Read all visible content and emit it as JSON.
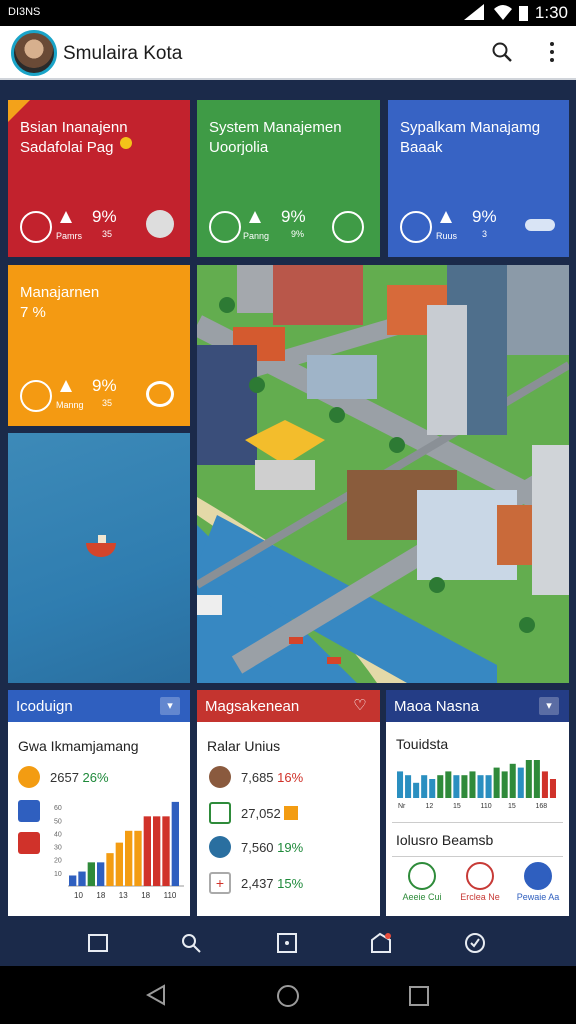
{
  "status_bar": {
    "carrier": "DI3NS",
    "time": "1:30"
  },
  "app": {
    "title": "Smulaira Kota"
  },
  "tiles": {
    "red": {
      "title": "Bsian Inanajenn\nSadafolai Pag",
      "pct": "9%",
      "small1": "Pamrs",
      "small2": "35",
      "color": "#c2222d"
    },
    "green": {
      "title": "System Manajemen\nUoorjolia",
      "pct": "9%",
      "small1": "Panng",
      "small2": "9%",
      "color": "#3f9b46"
    },
    "blue": {
      "title": "Sypalkam Manajamg\nBaaak",
      "pct": "9%",
      "small1": "Ruus",
      "small2": "3",
      "color": "#3763c4"
    },
    "orange": {
      "title": "Manajarnen\n7 %",
      "pct": "9%",
      "small1": "Manng",
      "small2": "35",
      "color": "#f49a12"
    }
  },
  "panel_left": {
    "header": "Icoduign",
    "subtitle": "Gwa Ikmamjamang",
    "stat1": "2657",
    "stat1_pct": "26%"
  },
  "panel_mid": {
    "header": "Magsakenean",
    "subtitle": "Ralar Unius",
    "rows": [
      {
        "value": "7,685",
        "pct": "16%"
      },
      {
        "value": "27,052",
        "pct": ""
      },
      {
        "value": "7,560",
        "pct": "19%"
      },
      {
        "value": "2,437",
        "pct": "15%"
      }
    ]
  },
  "panel_right": {
    "header": "Maoa Nasna",
    "chart_title": "Touidsta",
    "section": "Iolusro Beamsb",
    "actions": [
      {
        "label": "Aeeie Cui",
        "color": "#2e8b3a"
      },
      {
        "label": "Erclea Ne",
        "color": "#c73a36"
      },
      {
        "label": "Pewaie Aa",
        "color": "#2f5fbf"
      }
    ]
  },
  "chart_data": [
    {
      "type": "bar",
      "title": "",
      "ylabel": "",
      "ylim": [
        0,
        70
      ],
      "yticks": [
        10,
        20,
        30,
        40,
        50,
        60
      ],
      "x_labels": [
        "10",
        "18",
        "13",
        "18",
        "110"
      ],
      "values": [
        8,
        11,
        18,
        18,
        25,
        33,
        42,
        42,
        53,
        53,
        53,
        64
      ],
      "colors": [
        "#2f5fbf",
        "#2f5fbf",
        "#2f8a3a",
        "#2f5fbf",
        "#f39c12",
        "#f39c12",
        "#f39c12",
        "#f39c12",
        "#d0322a",
        "#d0322a",
        "#d0322a",
        "#2f5fbf"
      ]
    },
    {
      "type": "bar",
      "title": "Touidsta",
      "x_labels": [
        "Nr",
        "12",
        "15",
        "110",
        "15",
        "168"
      ],
      "values": [
        7,
        6,
        4,
        6,
        5,
        6,
        7,
        6,
        6,
        7,
        6,
        6,
        8,
        7,
        9,
        8,
        10,
        10,
        7,
        5
      ],
      "colors": [
        "#2a8fc0",
        "#2a8fc0",
        "#2a8fc0",
        "#2a8fc0",
        "#2a8fc0",
        "#2f8a3a",
        "#2f8a3a",
        "#2a8fc0",
        "#2f8a3a",
        "#2f8a3a",
        "#2a8fc0",
        "#2a8fc0",
        "#2f8a3a",
        "#2f8a3a",
        "#2f8a3a",
        "#2a8fc0",
        "#2f8a3a",
        "#2f8a3a",
        "#d0322a",
        "#d0322a"
      ]
    }
  ],
  "bottom_nav": [
    {
      "icon": "square-icon"
    },
    {
      "icon": "search-icon"
    },
    {
      "icon": "square-dot-icon"
    },
    {
      "icon": "edit-tag-icon"
    },
    {
      "icon": "check-circle-icon"
    }
  ]
}
